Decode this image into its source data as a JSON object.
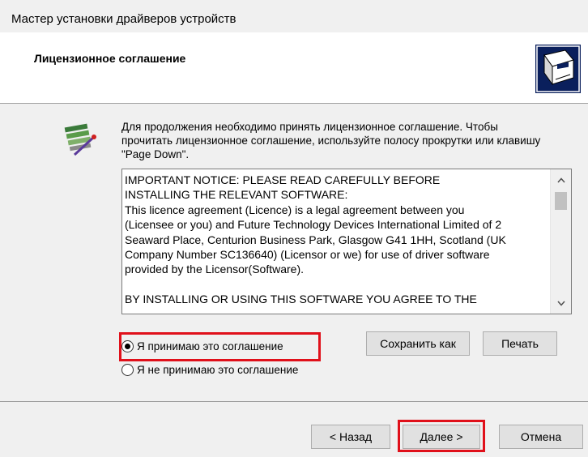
{
  "window": {
    "title": "Мастер установки драйверов устройств"
  },
  "header": {
    "title": "Лицензионное соглашение"
  },
  "intro": {
    "text": "Для продолжения необходимо принять лицензионное соглашение. Чтобы прочитать лицензионное соглашение, используйте полосу прокрутки или клавишу \"Page Down\"."
  },
  "license": {
    "text": "IMPORTANT NOTICE: PLEASE READ CAREFULLY BEFORE\nINSTALLING THE RELEVANT SOFTWARE:\nThis licence agreement (Licence) is a legal agreement between you\n(Licensee or you) and Future Technology Devices International Limited of 2\nSeaward Place, Centurion Business Park, Glasgow G41 1HH, Scotland (UK\nCompany Number SC136640) (Licensor or we) for use of driver software\nprovided by the Licensor(Software).\n\nBY INSTALLING OR USING THIS SOFTWARE YOU AGREE TO THE"
  },
  "options": {
    "accept_label": "Я принимаю это соглашение",
    "decline_label": "Я не принимаю это соглашение",
    "selected": "accept"
  },
  "buttons": {
    "save_as": "Сохранить как",
    "print": "Печать",
    "back": "< Назад",
    "next": "Далее >",
    "cancel": "Отмена"
  },
  "colors": {
    "highlight": "#e0101a"
  },
  "icons": [
    "wizard-icon",
    "installer-logo-icon",
    "chevron-up-icon",
    "chevron-down-icon"
  ]
}
